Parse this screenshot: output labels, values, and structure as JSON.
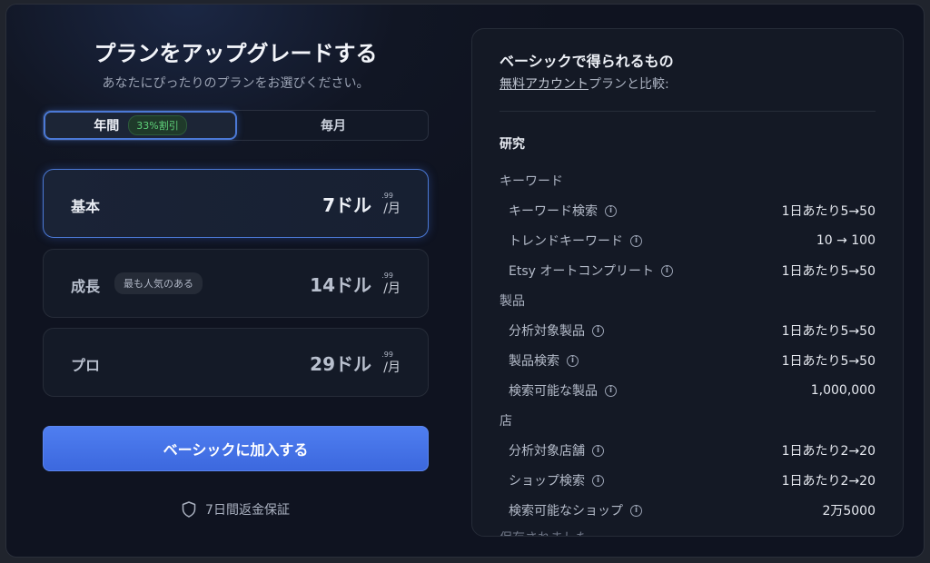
{
  "left": {
    "title": "プランをアップグレードする",
    "subtitle": "あなたにぴったりのプランをお選びください。",
    "billing_toggle": {
      "yearly_label": "年間",
      "discount_badge": "33%割引",
      "monthly_label": "毎月",
      "selected": "yearly"
    },
    "plans": [
      {
        "name": "基本",
        "price": "7ドル",
        "cents": ".99",
        "per": "/月",
        "badge": "",
        "selected": true
      },
      {
        "name": "成長",
        "price": "14ドル",
        "cents": ".99",
        "per": "/月",
        "badge": "最も人気のある",
        "selected": false
      },
      {
        "name": "プロ",
        "price": "29ドル",
        "cents": ".99",
        "per": "/月",
        "badge": "",
        "selected": false
      }
    ],
    "cta_label": "ベーシックに加入する",
    "guarantee_text": "7日間返金保証"
  },
  "right": {
    "heading": "ベーシックで得られるもの",
    "compare_link": "無料アカウント",
    "compare_suffix": "プランと比較:",
    "section": "研究",
    "groups": [
      {
        "category": "キーワード",
        "rows": [
          {
            "label": "キーワード検索",
            "value": "1日あたり5→50"
          },
          {
            "label": "トレンドキーワード",
            "value": "10 → 100"
          },
          {
            "label": "Etsy オートコンプリート",
            "value": "1日あたり5→50"
          }
        ]
      },
      {
        "category": "製品",
        "rows": [
          {
            "label": "分析対象製品",
            "value": "1日あたり5→50"
          },
          {
            "label": "製品検索",
            "value": "1日あたり5→50"
          },
          {
            "label": "検索可能な製品",
            "value": "1,000,000"
          }
        ]
      },
      {
        "category": "店",
        "rows": [
          {
            "label": "分析対象店舗",
            "value": "1日あたり2→20"
          },
          {
            "label": "ショップ検索",
            "value": "1日あたり2→20"
          },
          {
            "label": "検索可能なショップ",
            "value": "2万5000"
          }
        ]
      }
    ],
    "cut_off_text": "保存されました"
  },
  "colors": {
    "accent": "#4b79d6",
    "cta": "#3c68de",
    "discount_green": "#5fd17a",
    "background": "#111624"
  },
  "icons": {
    "info": "info-icon",
    "guarantee": "shield-icon"
  }
}
